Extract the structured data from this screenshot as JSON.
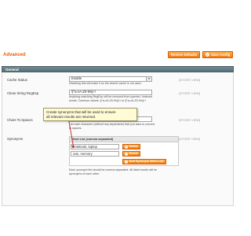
{
  "page": {
    "title": "Advanced"
  },
  "header": {
    "restore_defaults_label": "Restore Defaults",
    "save_config_label": "Save Config"
  },
  "section": {
    "title": "General"
  },
  "fields": {
    "cache_status": {
      "label": "Cache Status",
      "value": "Enable",
      "note": "Disabling this will make it so the search cache is not used.",
      "scope": "[STORE VIEW]"
    },
    "clean_regexp": {
      "label": "Clean String RegExp",
      "value": "/[^a-zA-Z0-9\\s]+/",
      "note_line1": "Anything matching RegExp will be removed from queries / indexed",
      "note_line2": "words. Common values: /[^a-zA-Z0-9\\s]+/ or /[^a-zA-Z0-9\\s]+/",
      "scope": "[STORE VIEW]"
    },
    "chars_to_spaces": {
      "label": "Chars To Spaces",
      "note_line1": "List each character (without any separators) that you want to convert",
      "note_line2": "to spaces.",
      "scope": "[STORE VIEW]"
    },
    "synonyms": {
      "label": "Synonyms",
      "table_header": "Word List (comma separated)",
      "rows": [
        {
          "value": "notebook, laptop",
          "delete_label": "Delete"
        },
        {
          "value": "ram, memory",
          "delete_label": "Delete"
        }
      ],
      "add_label": "Add Synonym Word List",
      "note_line1": "Each synonym list should be comma separated. All listed words will be",
      "note_line2": "synonyms of each other.",
      "scope": "[STORE VIEW]"
    }
  },
  "tooltip": {
    "text_line1": "Create synonyms that will be used to ensure",
    "text_line2": "all relevant  results are returned."
  },
  "colors": {
    "accent": "#eb5e00",
    "button": "#f07a10",
    "section_header": "#587078",
    "tooltip_bg": "#fffbd6"
  }
}
